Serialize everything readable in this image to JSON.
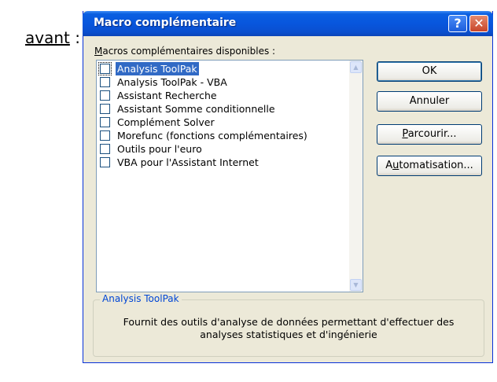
{
  "caption": {
    "prefix": "avant",
    "suffix": " :"
  },
  "window": {
    "title": "Macro complémentaire",
    "help_symbol": "?",
    "close_symbol": "✕"
  },
  "addins": {
    "label_accel": "M",
    "label_rest": "acros complémentaires disponibles :",
    "items": [
      {
        "label": "Analysis ToolPak",
        "checked": false,
        "selected": true
      },
      {
        "label": "Analysis ToolPak - VBA",
        "checked": false,
        "selected": false
      },
      {
        "label": "Assistant Recherche",
        "checked": false,
        "selected": false
      },
      {
        "label": "Assistant Somme conditionnelle",
        "checked": false,
        "selected": false
      },
      {
        "label": "Complément Solver",
        "checked": false,
        "selected": false
      },
      {
        "label": "Morefunc (fonctions complémentaires)",
        "checked": false,
        "selected": false
      },
      {
        "label": "Outils pour l'euro",
        "checked": false,
        "selected": false
      },
      {
        "label": "VBA pour l'Assistant Internet",
        "checked": false,
        "selected": false
      }
    ],
    "scroll_up": "▲",
    "scroll_down": "▼"
  },
  "buttons": {
    "ok": "OK",
    "cancel": "Annuler",
    "browse_accel": "P",
    "browse_rest": "arcourir...",
    "automation_pre": "A",
    "automation_accel": "u",
    "automation_rest": "tomatisation..."
  },
  "description": {
    "title": "Analysis ToolPak",
    "text": "Fournit des outils d'analyse de données permettant d'effectuer des analyses statistiques et d'ingénierie"
  }
}
